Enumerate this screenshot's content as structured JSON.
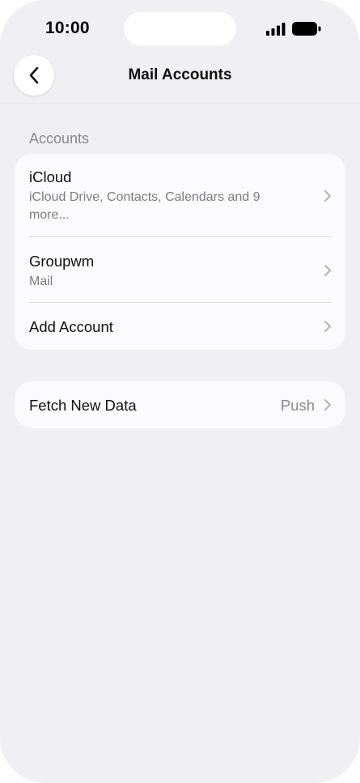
{
  "status_bar": {
    "time": "10:00",
    "signal_icon": "cellular-signal-icon",
    "battery_icon": "battery-icon"
  },
  "nav": {
    "title": "Mail Accounts",
    "back_icon": "chevron-left-icon"
  },
  "accounts_section": {
    "header": "Accounts",
    "items": [
      {
        "title": "iCloud",
        "subtitle": "iCloud Drive, Contacts, Calendars and 9 more..."
      },
      {
        "title": "Groupwm",
        "subtitle": "Mail"
      },
      {
        "title": "Add Account"
      }
    ]
  },
  "fetch_section": {
    "label": "Fetch New Data",
    "value": "Push"
  },
  "colors": {
    "background": "#f0eff4",
    "card": "#fbfbfd",
    "secondary_text": "#7c7c80"
  }
}
